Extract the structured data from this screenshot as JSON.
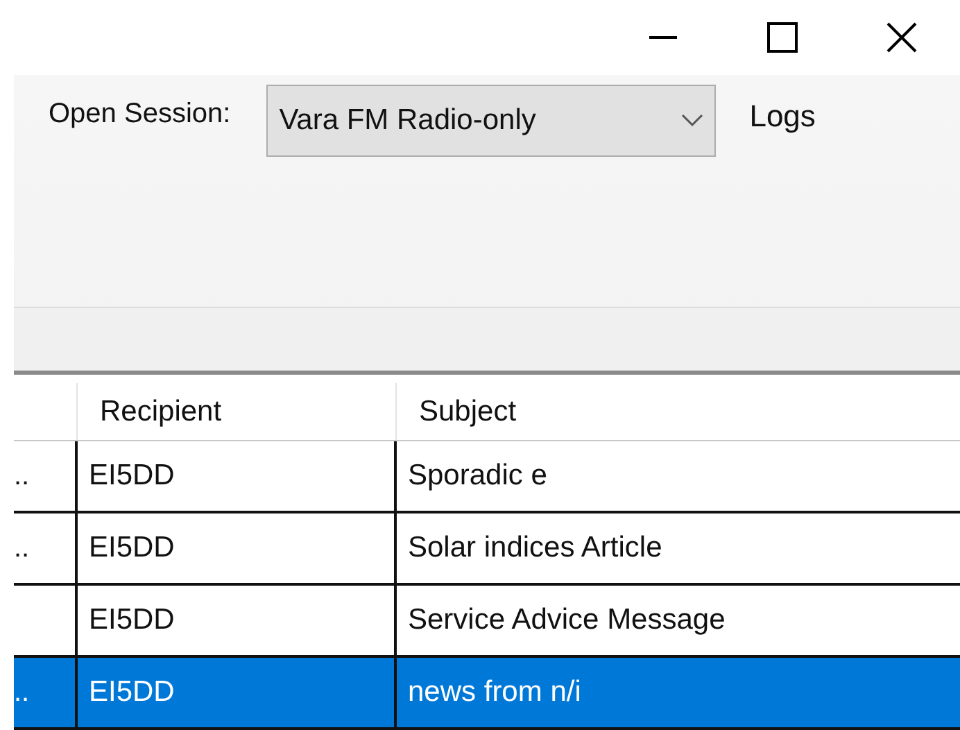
{
  "toolbar": {
    "session_label": "Open Session:",
    "session_value": "Vara FM Radio-only",
    "logs_label": "Logs"
  },
  "table": {
    "columns": [
      {
        "label": "Recipient"
      },
      {
        "label": "Subject"
      }
    ],
    "rows": [
      {
        "column_1": "..",
        "recipient": "EI5DD",
        "subject": "Sporadic e",
        "selected": false
      },
      {
        "column_1": "..",
        "recipient": "EI5DD",
        "subject": "Solar indices Article",
        "selected": false
      },
      {
        "recipient": "EI5DD",
        "subject": "Service Advice Message",
        "selected": false
      },
      {
        "column_1": "..",
        "recipient": "EI5DD",
        "subject": "news from n/i",
        "selected": true
      }
    ]
  }
}
